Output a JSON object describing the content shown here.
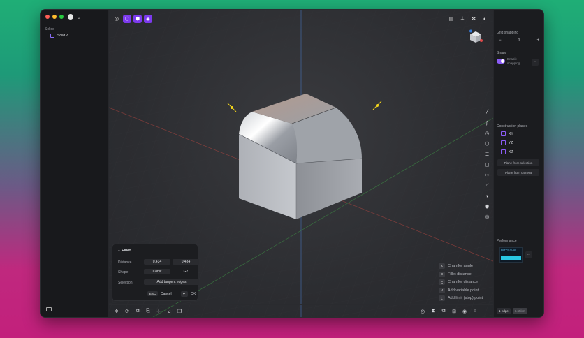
{
  "sidebar": {
    "section_title": "Solids",
    "items": [
      {
        "label": "Solid 2"
      }
    ]
  },
  "fillet_panel": {
    "title": "Fillet",
    "distance_label": "Distance",
    "distance_value_1": "0.434",
    "distance_value_2": "0.434",
    "shape_label": "Shape",
    "shape_option_1": "Conic",
    "shape_option_2": "G2",
    "selection_label": "Selection",
    "selection_button": "Add tangent edges",
    "esc_key": "ESC",
    "cancel_label": "Cancel",
    "ok_key": "↵",
    "ok_label": "OK"
  },
  "shortcuts": [
    {
      "key": "A",
      "label": "Chamfer angle"
    },
    {
      "key": "D",
      "label": "Fillet distance"
    },
    {
      "key": "C",
      "label": "Chamfer distance"
    },
    {
      "key": "V",
      "label": "Add variable point"
    },
    {
      "key": "L",
      "label": "Add limit (stop) point"
    }
  ],
  "right_panel": {
    "grid_snapping_label": "Grid snapping",
    "grid_value": "1",
    "stepper_minus": "−",
    "stepper_plus": "+",
    "snaps_label": "Snaps",
    "snap_toggle_text": "Enable snapping",
    "more": "⋯",
    "construction_planes_label": "Construction planes",
    "planes": [
      {
        "label": "XY"
      },
      {
        "label": "YZ"
      },
      {
        "label": "XZ"
      }
    ],
    "plane_from_selection": "Plane from selection",
    "plane_from_camera": "Plane from camera",
    "performance_label": "Performance",
    "fps_text": "60 FPS (0-60)",
    "selection_count": "1 edge",
    "selection_size": "1.65km"
  },
  "colors": {
    "accent": "#7c3aed",
    "toggle": "#8b5cf6",
    "x_axis": "#c24a4a",
    "y_axis": "#4aa64e",
    "z_axis": "#4a78c2"
  }
}
